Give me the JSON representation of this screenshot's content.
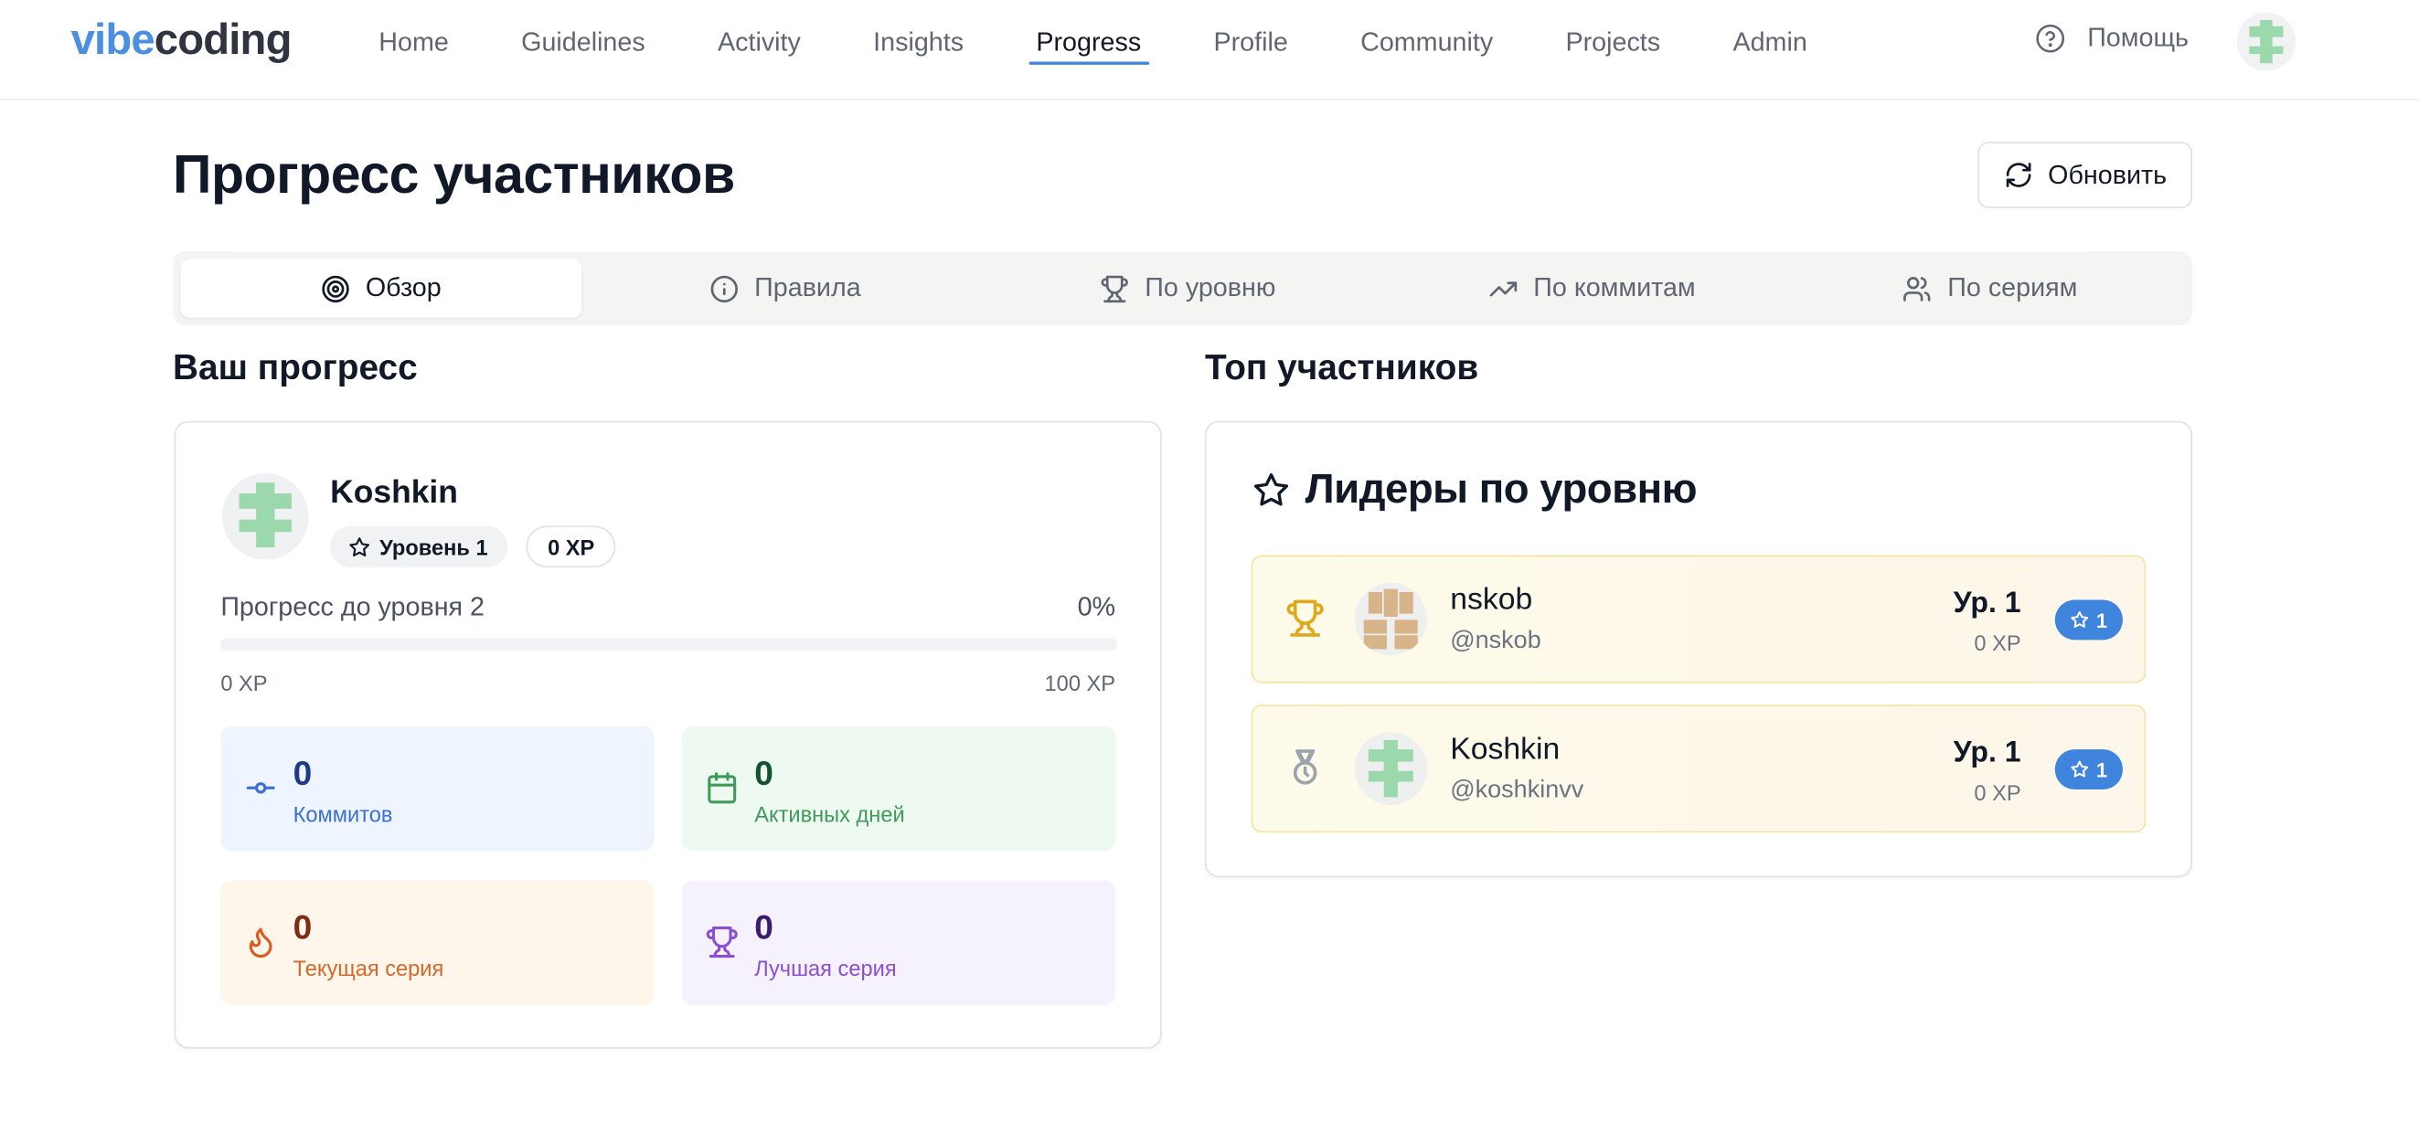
{
  "brand": {
    "part1": "vibe",
    "part2": "coding"
  },
  "nav": [
    {
      "label": "Home",
      "active": false
    },
    {
      "label": "Guidelines",
      "active": false
    },
    {
      "label": "Activity",
      "active": false
    },
    {
      "label": "Insights",
      "active": false
    },
    {
      "label": "Progress",
      "active": true
    },
    {
      "label": "Profile",
      "active": false
    },
    {
      "label": "Community",
      "active": false
    },
    {
      "label": "Projects",
      "active": false
    },
    {
      "label": "Admin",
      "active": false
    }
  ],
  "header": {
    "help_label": "Помощь",
    "help_icon": "help-circle-icon",
    "avatar_icon": "identicon-avatar"
  },
  "page": {
    "title": "Прогресс участников",
    "refresh_label": "Обновить"
  },
  "tabs": [
    {
      "label": "Обзор",
      "icon": "target-icon",
      "active": true
    },
    {
      "label": "Правила",
      "icon": "info-icon",
      "active": false
    },
    {
      "label": "По уровню",
      "icon": "trophy-icon",
      "active": false
    },
    {
      "label": "По коммитам",
      "icon": "trending-up-icon",
      "active": false
    },
    {
      "label": "По сериям",
      "icon": "users-icon",
      "active": false
    }
  ],
  "your_progress": {
    "heading": "Ваш прогресс",
    "user": {
      "name": "Koshkin",
      "level_label": "Уровень 1",
      "xp_label": "0 XP"
    },
    "progress": {
      "label": "Прогресс до уровня 2",
      "percent_text": "0%",
      "fraction": 0,
      "min_label": "0 XP",
      "max_label": "100 XP"
    },
    "stats": [
      {
        "value": "0",
        "label": "Коммитов",
        "icon": "git-commit-icon",
        "bg": "#eef5fe",
        "num_color": "#1e3a8a",
        "lab_color": "#3b6fd4",
        "ico_color": "#3b6fd4"
      },
      {
        "value": "0",
        "label": "Активных дней",
        "icon": "calendar-icon",
        "bg": "#eefaf1",
        "num_color": "#14532d",
        "lab_color": "#3f9a5a",
        "ico_color": "#3f9a5a"
      },
      {
        "value": "0",
        "label": "Текущая серия",
        "icon": "flame-icon",
        "bg": "#fef5eb",
        "num_color": "#7c2d12",
        "lab_color": "#d4692a",
        "ico_color": "#e05a1e"
      },
      {
        "value": "0",
        "label": "Лучшая серия",
        "icon": "trophy-icon",
        "bg": "#f6f2fd",
        "num_color": "#3b1d6e",
        "lab_color": "#8a4fd6",
        "ico_color": "#8a4fd6"
      }
    ]
  },
  "top": {
    "heading": "Топ участников",
    "card_title": "Лидеры по уровню",
    "rows": [
      {
        "name": "nskob",
        "handle": "@nskob",
        "level": "Ур. 1",
        "xp": "0 XP",
        "badge": "1",
        "rank_icon": "trophy-icon",
        "rank_color": "#e0a91c",
        "avatar_color": "#d8b48a"
      },
      {
        "name": "Koshkin",
        "handle": "@koshkinvv",
        "level": "Ур. 1",
        "xp": "0 XP",
        "badge": "1",
        "rank_icon": "medal-icon",
        "rank_color": "#9ca3af",
        "avatar_color": "#9bd8ac"
      }
    ]
  },
  "colors": {
    "accent": "#3f84dd",
    "brand_blue": "#4a8fe0"
  }
}
